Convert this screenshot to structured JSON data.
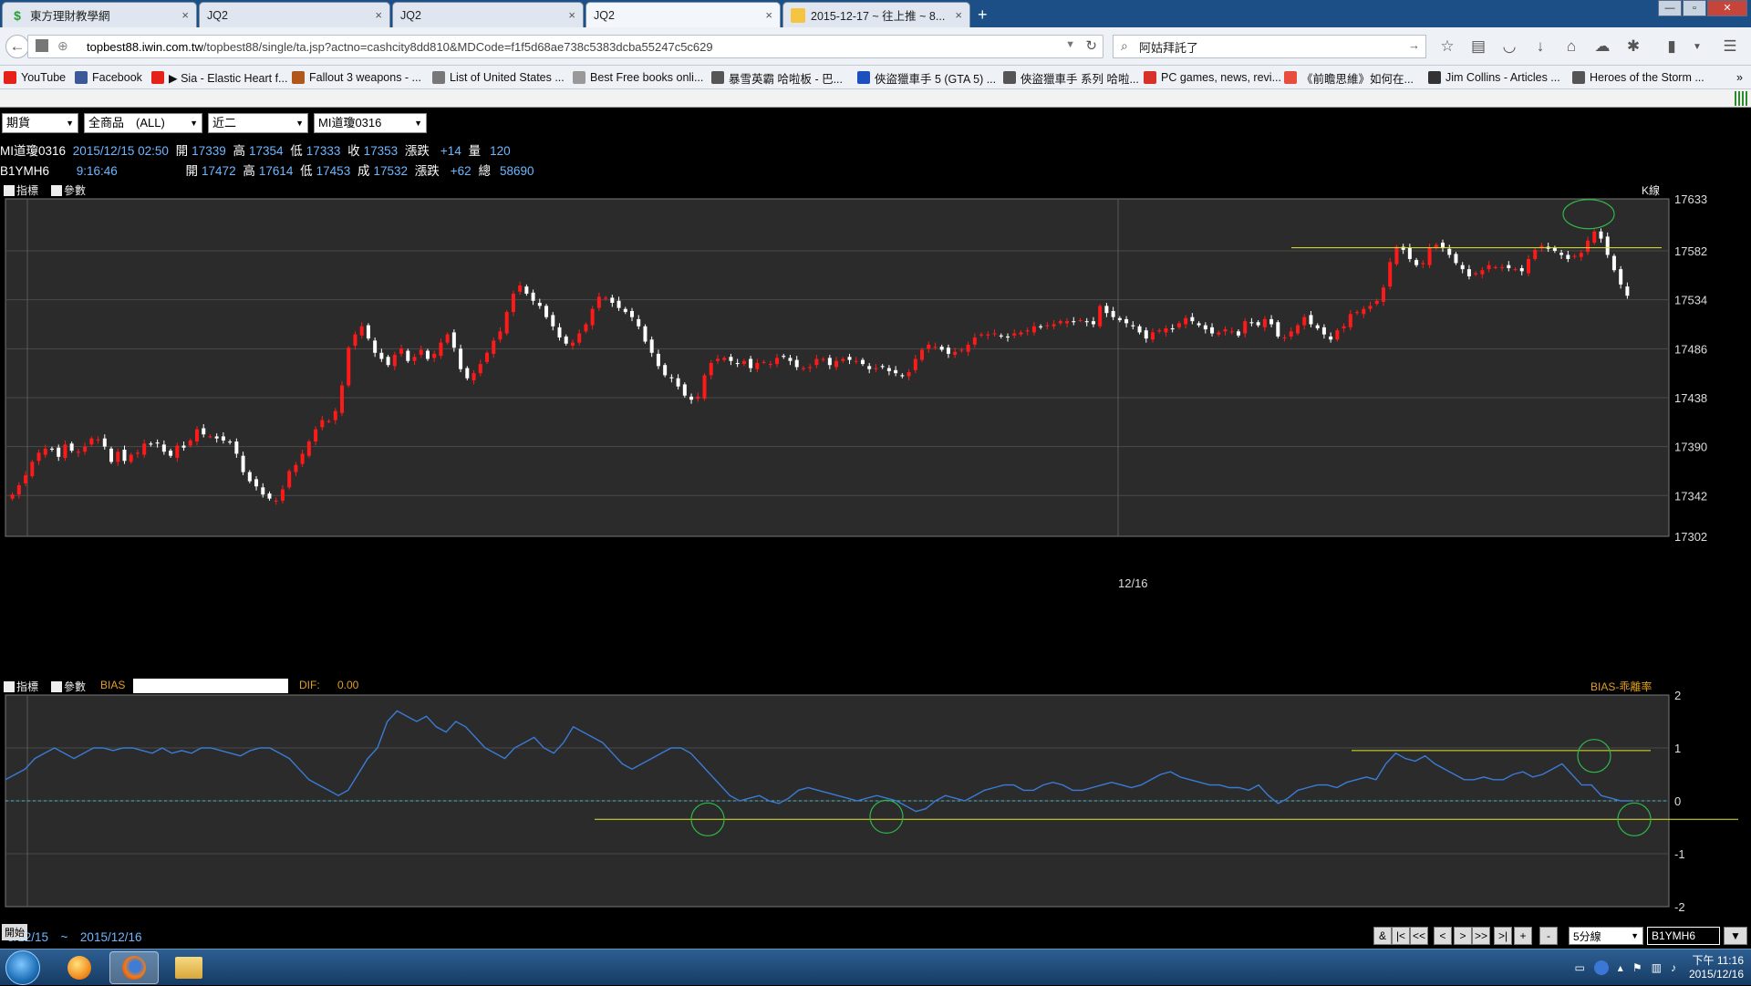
{
  "tabs": [
    {
      "title": "東方理財教學網",
      "icon": "dollar-icon",
      "active": false
    },
    {
      "title": "JQ2",
      "icon": "",
      "active": false
    },
    {
      "title": "JQ2",
      "icon": "",
      "active": false
    },
    {
      "title": "JQ2",
      "icon": "",
      "active": true
    },
    {
      "title": "2015-12-17 ~ 往上推 ~ 8...",
      "icon": "note-icon",
      "active": false
    }
  ],
  "nav": {
    "url_host": "topbest88.iwin.com.tw",
    "url_path": "/topbest88/single/ta.jsp?actno=cashcity8dd810&MDCode=f1f5d68ae738c5383dcba55247c5c629",
    "search_value": "阿姑拜託了"
  },
  "bookmarks": [
    {
      "label": "YouTube",
      "icon": "youtube-icon",
      "color": "#e62117"
    },
    {
      "label": "Facebook",
      "icon": "facebook-icon",
      "color": "#3b5998"
    },
    {
      "label": "▶ Sia - Elastic Heart f...",
      "icon": "youtube-icon",
      "color": "#e62117"
    },
    {
      "label": "Fallout 3 weapons - ...",
      "icon": "fallout-icon",
      "color": "#b0581b"
    },
    {
      "label": "List of United States ...",
      "icon": "wikipedia-icon",
      "color": "#777777"
    },
    {
      "label": "Best Free books onli...",
      "icon": "page-icon",
      "color": "#999999"
    },
    {
      "label": "暴雪英霸 哈啦板 - 巴...",
      "icon": "bahamut-icon",
      "color": "#555555"
    },
    {
      "label": "俠盜獵車手 5 (GTA 5) ...",
      "icon": "shield-icon",
      "color": "#1e4fbf"
    },
    {
      "label": "俠盜獵車手 系列 哈啦...",
      "icon": "bahamut-icon",
      "color": "#555555"
    },
    {
      "label": "PC games, news, revi...",
      "icon": "gamespot-icon",
      "color": "#d8312a"
    },
    {
      "label": "《前瞻思維》如何在...",
      "icon": "news-icon",
      "color": "#e74c3c"
    },
    {
      "label": "Jim Collins - Articles ...",
      "icon": "signature-icon",
      "color": "#333333"
    },
    {
      "label": "Heroes of the Storm ...",
      "icon": "heroes-icon",
      "color": "#555555"
    }
  ],
  "toolbar": {
    "market": "期貨",
    "product": "全商品　(ALL)",
    "contract_month": "近二",
    "symbol": "MI道瓊0316"
  },
  "quote1": {
    "symbol": "MI道瓊0316",
    "datetime": "2015/12/15 02:50",
    "open_label": "開",
    "open": "17339",
    "high_label": "高",
    "high": "17354",
    "low_label": "低",
    "low": "17333",
    "close_label": "收",
    "close": "17353",
    "change_label": "漲跌",
    "change": "+14",
    "volume_label": "量",
    "volume": "120"
  },
  "quote2": {
    "symbol": "B1YMH6",
    "time": "9:16:46",
    "open_label": "開",
    "open": "17472",
    "high_label": "高",
    "high": "17614",
    "low_label": "低",
    "low": "17453",
    "last_label": "成",
    "last": "17532",
    "change_label": "漲跌",
    "change": "+62",
    "total_label": "總",
    "total": "58690"
  },
  "main_panel": {
    "indicator_label": "指標",
    "param_label": "參數",
    "chart_type_label": "K線",
    "date_marker": "12/16"
  },
  "bias_panel": {
    "indicator_label": "指標",
    "param_label": "參數",
    "name": "BIAS",
    "dif_label": "DIF:",
    "dif_value": "0.00",
    "right_label": "BIAS-乖離率"
  },
  "bottom": {
    "start_label": "開始",
    "date_range": "5/12/15　~　2015/12/16",
    "nav_buttons": [
      "&",
      "|<",
      "<<",
      "<",
      ">",
      ">>",
      ">|",
      "+",
      "-"
    ],
    "interval": "5分線",
    "symbol_input": "B1YMH6"
  },
  "taskbar": {
    "time": "下午 11:16",
    "date": "2015/12/16"
  },
  "chart_data": [
    {
      "type": "candlestick",
      "title": "",
      "ylim": [
        17302,
        17633
      ],
      "y_ticks": [
        17302,
        17342,
        17390,
        17438,
        17486,
        17534,
        17582,
        17633
      ],
      "x_label_marker": "12/16",
      "series_close": [
        17343,
        17352,
        17362,
        17375,
        17384,
        17388,
        17387,
        17380,
        17392,
        17386,
        17385,
        17390,
        17398,
        17397,
        17390,
        17375,
        17385,
        17376,
        17382,
        17384,
        17393,
        17392,
        17393,
        17385,
        17381,
        17391,
        17389,
        17396,
        17407,
        17402,
        17400,
        17398,
        17396,
        17394,
        17383,
        17365,
        17356,
        17351,
        17343,
        17339,
        17337,
        17348,
        17366,
        17372,
        17383,
        17395,
        17407,
        17416,
        17415,
        17425,
        17450,
        17487,
        17500,
        17508,
        17496,
        17482,
        17476,
        17470,
        17480,
        17486,
        17474,
        17478,
        17485,
        17476,
        17481,
        17492,
        17500,
        17487,
        17466,
        17457,
        17462,
        17471,
        17482,
        17494,
        17503,
        17522,
        17540,
        17548,
        17540,
        17533,
        17528,
        17517,
        17508,
        17497,
        17491,
        17492,
        17501,
        17510,
        17525,
        17537,
        17536,
        17531,
        17526,
        17522,
        17517,
        17508,
        17493,
        17482,
        17469,
        17460,
        17457,
        17449,
        17440,
        17436,
        17439,
        17460,
        17472,
        17476,
        17477,
        17474,
        17471,
        17474,
        17467,
        17472,
        17473,
        17471,
        17477,
        17478,
        17474,
        17468,
        17467,
        17468,
        17476,
        17476,
        17470,
        17474,
        17476,
        17475,
        17474,
        17471,
        17466,
        17467,
        17468,
        17464,
        17462,
        17459,
        17463,
        17476,
        17485,
        17490,
        17488,
        17485,
        17481,
        17483,
        17485,
        17490,
        17497,
        17500,
        17500,
        17501,
        17498,
        17497,
        17501,
        17502,
        17504,
        17508,
        17507,
        17509,
        17510,
        17513,
        17513,
        17512,
        17514,
        17512,
        17510,
        17528,
        17521,
        17517,
        17514,
        17511,
        17508,
        17502,
        17496,
        17502,
        17504,
        17506,
        17505,
        17511,
        17516,
        17513,
        17509,
        17505,
        17501,
        17502,
        17505,
        17503,
        17499,
        17513,
        17511,
        17509,
        17515,
        17510,
        17498,
        17497,
        17503,
        17509,
        17517,
        17510,
        17506,
        17500,
        17495,
        17504,
        17508,
        17520,
        17522,
        17525,
        17528,
        17533,
        17546,
        17571,
        17586,
        17583,
        17574,
        17568,
        17570,
        17585,
        17588,
        17585,
        17578,
        17570,
        17564,
        17557,
        17560,
        17563,
        17568,
        17566,
        17566,
        17565,
        17564,
        17562,
        17574,
        17583,
        17587,
        17584,
        17582,
        17578,
        17574,
        17577,
        17580,
        17592,
        17601,
        17594,
        17578,
        17563,
        17549,
        17538
      ]
    },
    {
      "type": "line",
      "title": "BIAS",
      "ylim": [
        -2,
        2
      ],
      "y_ticks": [
        -2,
        -1,
        0,
        1,
        2
      ],
      "series": [
        {
          "values": [
            0.4,
            0.5,
            0.6,
            0.8,
            0.9,
            1.0,
            0.9,
            0.8,
            0.9,
            1.0,
            1.0,
            0.95,
            1.0,
            1.0,
            0.95,
            0.9,
            1.0,
            0.9,
            0.95,
            0.9,
            1.0,
            1.0,
            0.95,
            0.9,
            0.85,
            0.95,
            1.0,
            1.0,
            0.9,
            0.8,
            0.6,
            0.4,
            0.3,
            0.2,
            0.1,
            0.2,
            0.5,
            0.8,
            1.0,
            1.5,
            1.7,
            1.6,
            1.5,
            1.6,
            1.4,
            1.3,
            1.5,
            1.4,
            1.2,
            1.0,
            0.9,
            0.8,
            1.0,
            1.1,
            1.2,
            1.0,
            0.9,
            1.1,
            1.4,
            1.3,
            1.2,
            1.1,
            0.9,
            0.7,
            0.6,
            0.7,
            0.8,
            0.9,
            1.0,
            1.0,
            0.9,
            0.7,
            0.5,
            0.3,
            0.1,
            0.0,
            0.05,
            0.1,
            0.0,
            -0.05,
            0.05,
            0.2,
            0.25,
            0.2,
            0.15,
            0.1,
            0.05,
            0.0,
            0.05,
            0.1,
            0.05,
            0.0,
            -0.1,
            -0.2,
            -0.15,
            0.0,
            0.1,
            0.05,
            0.0,
            0.1,
            0.2,
            0.25,
            0.3,
            0.3,
            0.2,
            0.2,
            0.3,
            0.35,
            0.3,
            0.2,
            0.2,
            0.25,
            0.3,
            0.35,
            0.3,
            0.25,
            0.3,
            0.4,
            0.5,
            0.55,
            0.45,
            0.4,
            0.35,
            0.3,
            0.3,
            0.25,
            0.25,
            0.2,
            0.3,
            0.1,
            -0.05,
            0.05,
            0.2,
            0.25,
            0.3,
            0.3,
            0.25,
            0.35,
            0.4,
            0.45,
            0.4,
            0.7,
            0.9,
            0.8,
            0.75,
            0.85,
            0.7,
            0.6,
            0.5,
            0.4,
            0.4,
            0.45,
            0.4,
            0.4,
            0.5,
            0.55,
            0.45,
            0.5,
            0.6,
            0.7,
            0.5,
            0.3,
            0.3,
            0.1,
            0.05,
            0.0,
            0.0
          ]
        }
      ],
      "zero_line": 0
    }
  ]
}
